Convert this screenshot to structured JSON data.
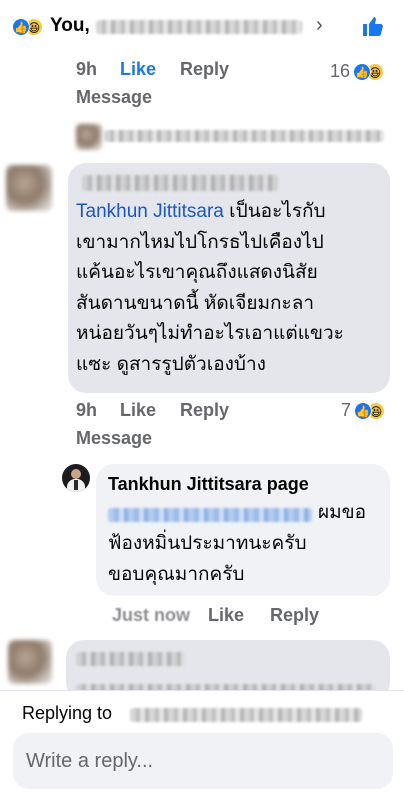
{
  "top": {
    "you_label": "You,",
    "chevron": "›",
    "reactions": [
      "like",
      "haha"
    ]
  },
  "comment_0": {
    "time": "9h",
    "like_label": "Like",
    "reply_label": "Reply",
    "message_label": "Message",
    "reaction_count": "16"
  },
  "comment_1": {
    "mention": "Tankhun Jittitsara",
    "text_lines": [
      " เป็นอะไรกับ",
      "เขามากไหมไปโกรธไปเคืองไป",
      "แค้นอะไรเขาคุณถึงแสดงนิสัย",
      "สันดานขนาดนี้ หัดเจียมกะลา",
      "หน่อยวันๆไม่ทำอะไรเอาแต่แขวะ",
      "แซะ ดูสารรูปตัวเองบ้าง"
    ],
    "time": "9h",
    "like_label": "Like",
    "reply_label": "Reply",
    "message_label": "Message",
    "reaction_count": "7"
  },
  "reply_1": {
    "author": "Tankhun Jittitsara page",
    "text_line1_suffix": "ผมขอ",
    "text_lines": [
      "ฟ้องหมิ่นประมาทนะครับ",
      "ขอบคุณมากครับ"
    ],
    "time": "Just now",
    "like_label": "Like",
    "reply_label": "Reply"
  },
  "composer": {
    "replying_to_label": "Replying to",
    "placeholder": "Write a reply..."
  },
  "colors": {
    "accent_blue": "#1877f2",
    "mention_blue": "#1a55c9",
    "bubble_gray": "#e4e6eb",
    "meta_gray": "#65676b"
  }
}
